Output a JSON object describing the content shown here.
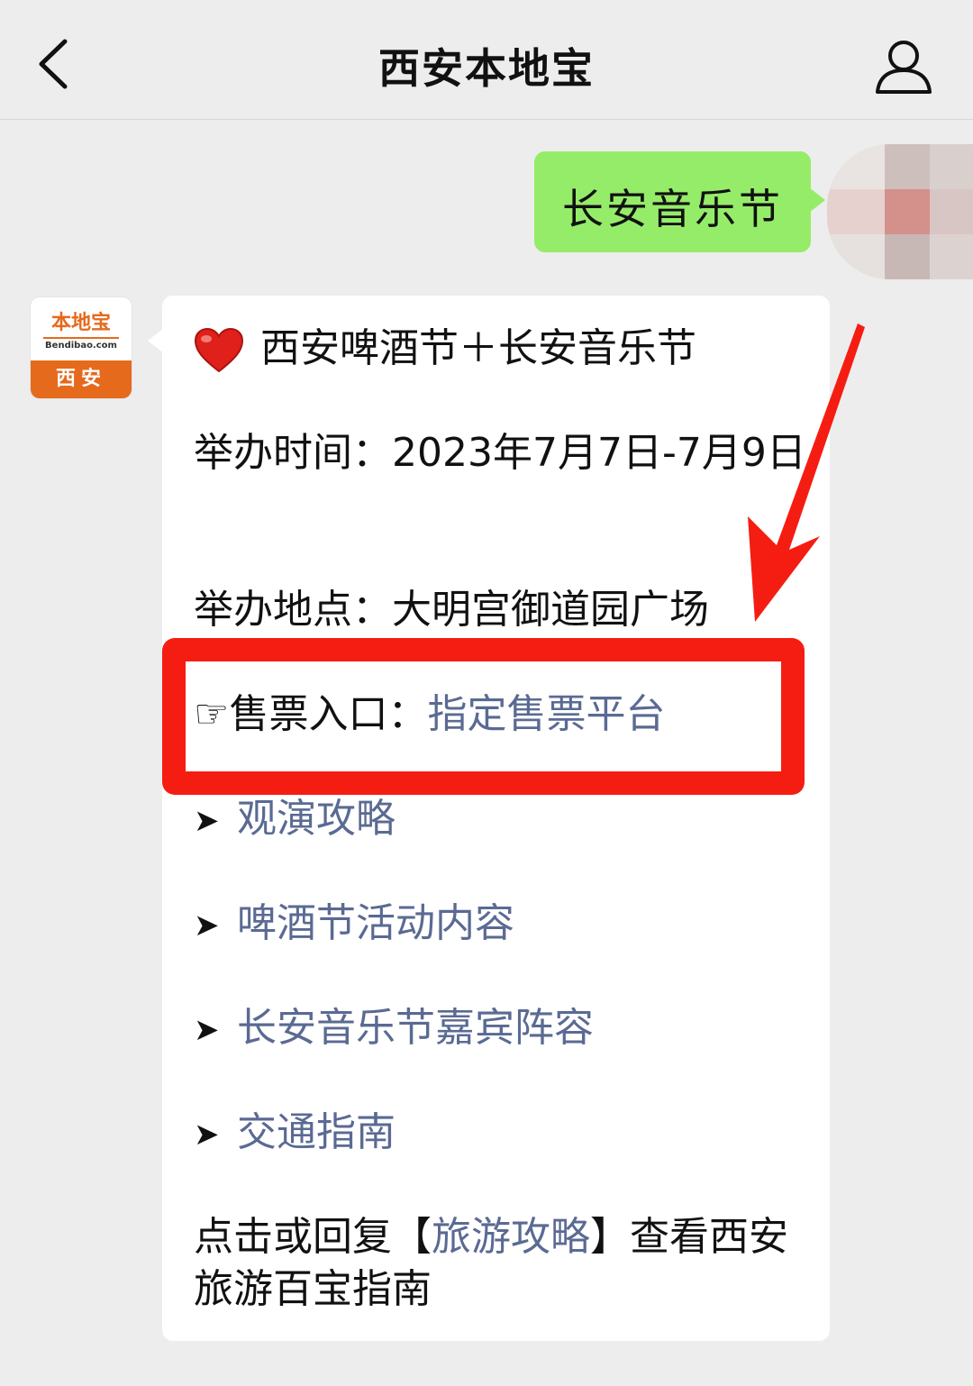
{
  "header": {
    "title": "西安本地宝",
    "back_icon": "chevron-left-icon",
    "user_icon": "person-icon"
  },
  "chat": {
    "user_message": "长安音乐节",
    "bot_avatar": {
      "logo_text": "本地宝",
      "logo_domain": "Bendibao.com",
      "logo_city": "西安"
    },
    "bot_message": {
      "title": "西安啤酒节＋长安音乐节",
      "time_label": "举办时间：",
      "time_value": "2023年7月7日-7月9日",
      "place_label": "举办地点：",
      "place_value": "大明宫御道园广场",
      "ticket_label": "☞售票入口：",
      "ticket_link": "指定售票平台",
      "links": [
        {
          "marker": "➤",
          "label": "观演攻略"
        },
        {
          "marker": "➤",
          "label": "啤酒节活动内容"
        },
        {
          "marker": "➤",
          "label": "长安音乐节嘉宾阵容"
        },
        {
          "marker": "➤",
          "label": "交通指南"
        }
      ],
      "footer_prefix": "点击或回复【",
      "footer_link": "旅游攻略",
      "footer_suffix": "】查看西安旅游百宝指南"
    }
  },
  "colors": {
    "background": "#ededed",
    "user_bubble": "#95ec69",
    "bot_bubble": "#ffffff",
    "link": "#5a6a93",
    "highlight": "#f51d12",
    "brand": "#e56a1c"
  }
}
